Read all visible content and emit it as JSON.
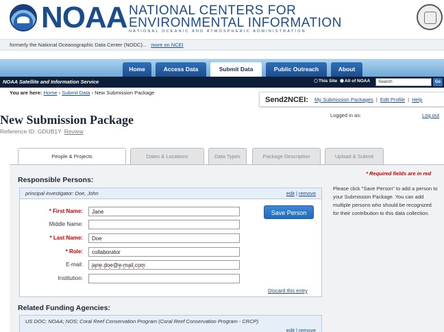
{
  "header": {
    "logo_text": "NOAA",
    "center_line1": "NATIONAL CENTERS FOR",
    "center_line2": "ENVIRONMENTAL INFORMATION",
    "center_line3": "NATIONAL OCEANIC AND ATMOSPHERIC ADMINISTRATION"
  },
  "formerly": {
    "text": "formerly the National Oceanographic Data Center (NODC)...",
    "link": "more on NCEI"
  },
  "nav": {
    "items": [
      "Home",
      "Access Data",
      "Submit Data",
      "Public Outreach",
      "About"
    ],
    "active": "Submit Data"
  },
  "service_bar": {
    "label": "NOAA Satellite and Information Service",
    "scope_this_site": "This Site",
    "scope_all_noaa": "All of NOAA",
    "search_placeholder": "Search",
    "go_label": "Go"
  },
  "breadcrumb": {
    "prefix": "You are here:",
    "items": [
      "Home",
      "Submit Data",
      "New Submission Package"
    ],
    "separator": "›"
  },
  "send2ncei": {
    "title": "Send2NCEI:",
    "links": [
      "My Submission Packages",
      "Edit Profile",
      "Help"
    ],
    "separator": "|",
    "logged_in_label": "Logged in as:",
    "logout": "Log out"
  },
  "page": {
    "title": "New Submission Package",
    "reference_id": "Reference ID: GDUB1Y",
    "review_link": "Review"
  },
  "tabs": [
    {
      "label": "People & Projects",
      "active": true
    },
    {
      "label": "Dates & Locations",
      "active": false
    },
    {
      "label": "Data Types",
      "active": false
    },
    {
      "label": "Package Description",
      "active": false
    },
    {
      "label": "Upload & Submit",
      "active": false
    }
  ],
  "required_note": "* Required fields are in red",
  "responsible_persons": {
    "heading": "Responsible Persons:",
    "existing": "principal investigator: Doe, John",
    "edit": "edit",
    "sep": "|",
    "remove": "remove",
    "fields": [
      {
        "label": "First Name:",
        "required": true,
        "value": "Jane"
      },
      {
        "label": "Middle Name:",
        "required": false,
        "value": ""
      },
      {
        "label": "Last Name:",
        "required": true,
        "value": "Doe"
      },
      {
        "label": "Role:",
        "required": true,
        "value": "collaborator"
      },
      {
        "label": "E-mail:",
        "required": false,
        "value": "jane.doe@e-mail.com"
      },
      {
        "label": "Institution:",
        "required": false,
        "value": ""
      }
    ],
    "save_button": "Save Person",
    "discard": "Discard this entry",
    "help_text": "Please click \"Save Person\" to add a person to your Submission Package. You can add multiple persons who should be recognized for their contribution to this data collection."
  },
  "funding": {
    "heading": "Related Funding Agencies:",
    "entry": "US DOC; NOAA; NOS; Coral Reef Conservation Program (Coral Reef Conservation Program - CRCP)",
    "edit": "edit",
    "sep": "|",
    "remove": "remove"
  },
  "colors": {
    "brand_blue": "#1b4c8c",
    "nav_band": "#6fa9d7",
    "dark_bar": "#0d1f38",
    "required_red": "#cc0000",
    "save_button": "#236cbd"
  }
}
